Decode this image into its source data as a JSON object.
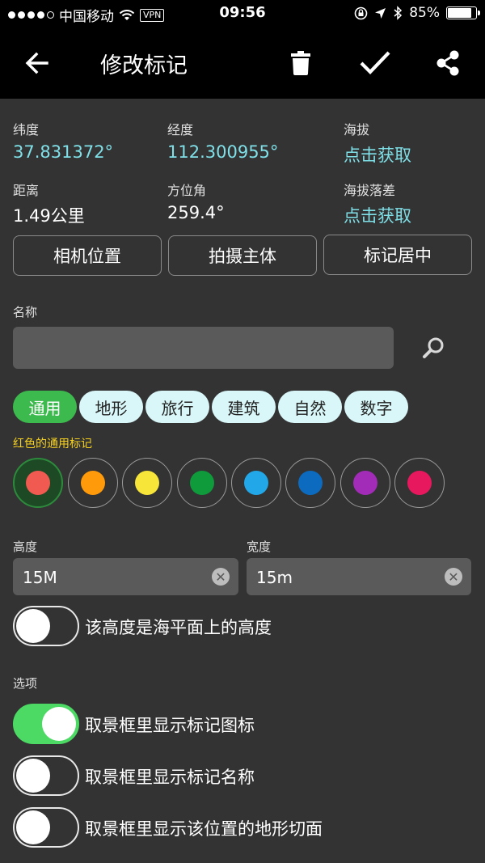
{
  "status_bar": {
    "carrier": "中国移动",
    "vpn": "VPN",
    "time": "09:56",
    "battery": "85%",
    "battery_level": 0.85
  },
  "toolbar": {
    "title": "修改标记",
    "back_icon": "arrow-left-icon",
    "delete_icon": "trash-icon",
    "confirm_icon": "check-icon",
    "share_icon": "share-icon"
  },
  "info": {
    "latitude_label": "纬度",
    "latitude_value": "37.831372°",
    "longitude_label": "经度",
    "longitude_value": "112.300955°",
    "altitude_label": "海拔",
    "altitude_value": "点击获取",
    "distance_label": "距离",
    "distance_value": "1.49公里",
    "bearing_label": "方位角",
    "bearing_value": "259.4°",
    "altitude_diff_label": "海拔落差",
    "altitude_diff_value": "点击获取"
  },
  "actions": {
    "camera_position": "相机位置",
    "shoot_subject": "拍摄主体",
    "center_marker": "标记居中"
  },
  "name": {
    "label": "名称",
    "value": "",
    "search_icon": "search-icon"
  },
  "categories": [
    {
      "label": "通用",
      "active": true
    },
    {
      "label": "地形",
      "active": false
    },
    {
      "label": "旅行",
      "active": false
    },
    {
      "label": "建筑",
      "active": false
    },
    {
      "label": "自然",
      "active": false
    },
    {
      "label": "数字",
      "active": false
    }
  ],
  "marker_subtitle": "红色的通用标记",
  "colors": [
    "#f05a50",
    "#ff9a0a",
    "#f7e53a",
    "#0f9a3c",
    "#22a8e8",
    "#0c6bbf",
    "#a22cb8",
    "#e8185e"
  ],
  "dimensions": {
    "height_label": "高度",
    "height_value": "15M",
    "width_label": "宽度",
    "width_value": "15m"
  },
  "sea_level_toggle": {
    "label": "该高度是海平面上的高度",
    "on": false
  },
  "options": {
    "label": "选项",
    "items": [
      {
        "label": "取景框里显示标记图标",
        "on": true
      },
      {
        "label": "取景框里显示标记名称",
        "on": false
      },
      {
        "label": "取景框里显示该位置的地形切面",
        "on": false
      }
    ]
  }
}
